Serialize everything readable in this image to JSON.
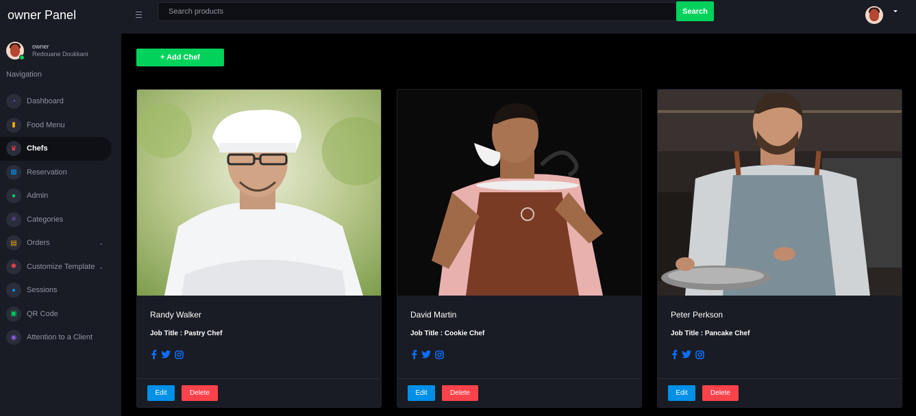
{
  "sidebar": {
    "brand": "owner Panel",
    "profile": {
      "role": "owner",
      "name": "Redouane Doukkani"
    },
    "nav_title": "Navigation",
    "items": [
      {
        "label": "Dashboard",
        "icon": "speedometer-icon",
        "color": "#8f5fe8",
        "glyph": "◔",
        "active": false,
        "chevron": false
      },
      {
        "label": "Food Menu",
        "icon": "food-menu-icon",
        "color": "#ffab00",
        "glyph": "▮",
        "active": false,
        "chevron": false
      },
      {
        "label": "Chefs",
        "icon": "chef-hat-icon",
        "color": "#fc424a",
        "glyph": "♛",
        "active": true,
        "chevron": false
      },
      {
        "label": "Reservation",
        "icon": "calendar-icon",
        "color": "#0090e7",
        "glyph": "▦",
        "active": false,
        "chevron": false
      },
      {
        "label": "Admin",
        "icon": "users-icon",
        "color": "#00d25b",
        "glyph": "●",
        "active": false,
        "chevron": false
      },
      {
        "label": "Categories",
        "icon": "list-icon",
        "color": "#8f5fe8",
        "glyph": "≡",
        "active": false,
        "chevron": false
      },
      {
        "label": "Orders",
        "icon": "clipboard-icon",
        "color": "#ffab00",
        "glyph": "▤",
        "active": false,
        "chevron": true
      },
      {
        "label": "Customize Template",
        "icon": "settings-icon",
        "color": "#fc424a",
        "glyph": "✱",
        "active": false,
        "chevron": true
      },
      {
        "label": "Sessions",
        "icon": "sessions-icon",
        "color": "#0090e7",
        "glyph": "●",
        "active": false,
        "chevron": false
      },
      {
        "label": "QR Code",
        "icon": "qr-code-icon",
        "color": "#00d25b",
        "glyph": "▣",
        "active": false,
        "chevron": false
      },
      {
        "label": "Attention to a Client",
        "icon": "eye-icon",
        "color": "#8f5fe8",
        "glyph": "◉",
        "active": false,
        "chevron": false
      }
    ]
  },
  "topbar": {
    "search_placeholder": "Search products",
    "search_button": "Search"
  },
  "main": {
    "add_button": "+ Add Chef",
    "job_prefix": "Job Title : ",
    "chefs": [
      {
        "name": "Randy Walker",
        "job_title": "Pastry Chef",
        "edit": "Edit",
        "delete": "Delete"
      },
      {
        "name": "David Martin",
        "job_title": "Cookie Chef",
        "edit": "Edit",
        "delete": "Delete"
      },
      {
        "name": "Peter Perkson",
        "job_title": "Pancake Chef",
        "edit": "Edit",
        "delete": "Delete"
      }
    ]
  },
  "colors": {
    "accent_green": "#00d25b",
    "edit_blue": "#0090e7",
    "delete_red": "#fc424a",
    "social_blue": "#0d6efd",
    "panel": "#191c24"
  }
}
